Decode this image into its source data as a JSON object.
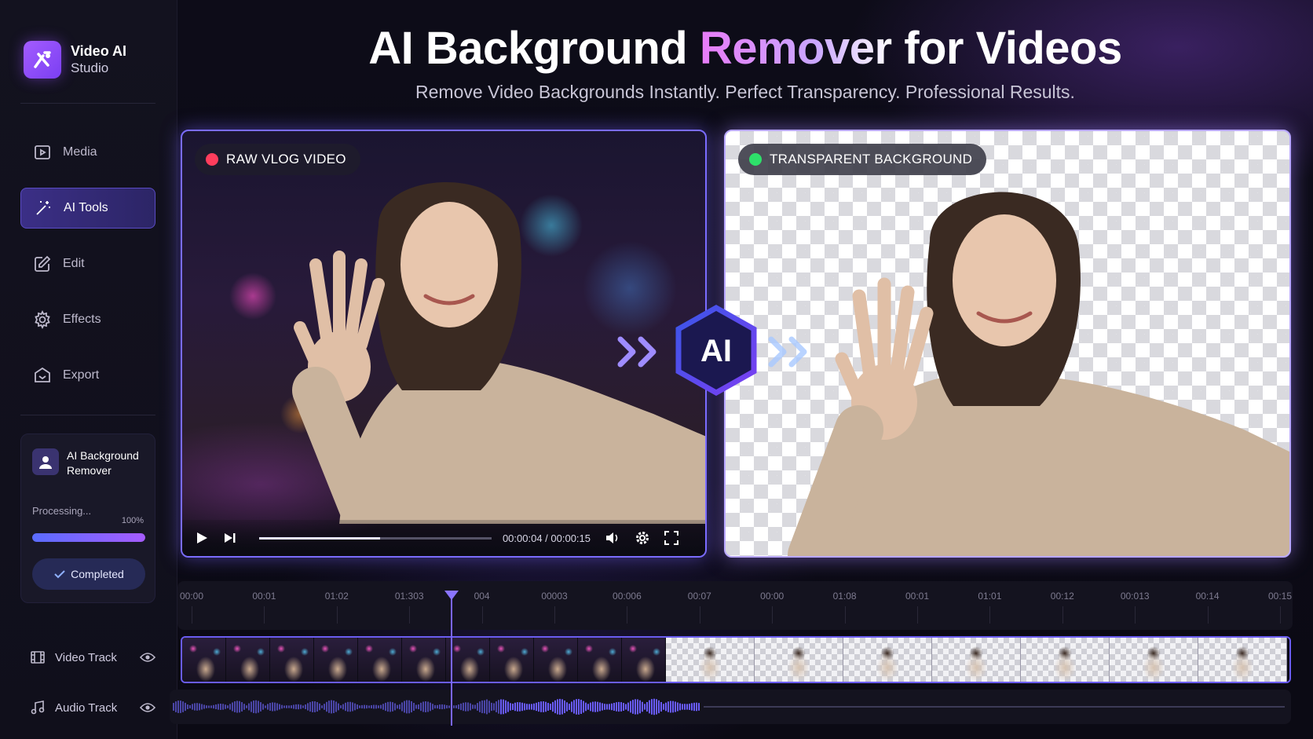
{
  "brand": {
    "name": "Video AI",
    "sub": "Studio"
  },
  "header": {
    "title_part1": "AI Background ",
    "title_part2": "Remover",
    "title_part3": " for Videos",
    "subtitle": "Remove Video Backgrounds Instantly. Perfect Transparency. Professional Results."
  },
  "sidebar": {
    "items": [
      {
        "label": "Media",
        "icon": "folder-icon"
      },
      {
        "label": "AI Tools",
        "icon": "magic-wand-icon",
        "active": true
      },
      {
        "label": "Edit",
        "icon": "edit-icon"
      },
      {
        "label": "Effects",
        "icon": "gear-icon"
      },
      {
        "label": "Export",
        "icon": "export-icon"
      }
    ]
  },
  "tool_card": {
    "name": "AI Background Remover",
    "status": "Processing...",
    "percent_label": "100%",
    "progress": 1.0,
    "button": "Completed"
  },
  "left_panel": {
    "badge": "RAW VLOG VIDEO",
    "badge_color": "#ff3d5c",
    "time": "00:00:04 / 00:00:15",
    "progress": 0.52
  },
  "right_panel": {
    "badge": "TRANSPARENT BACKGROUND",
    "badge_color": "#2ee06a"
  },
  "ai_badge": {
    "label": "AI"
  },
  "timeline": {
    "ticks": [
      "00:00",
      "00:01",
      "01:02",
      "01:303",
      "004",
      "00003",
      "00:006",
      "00:07",
      "00:00",
      "01:08",
      "00:01",
      "01:01",
      "00:12",
      "00:013",
      "00:14",
      "00:15"
    ],
    "tracks": [
      {
        "label": "Video Track",
        "icon": "film-icon"
      },
      {
        "label": "Audio Track",
        "icon": "music-icon"
      }
    ]
  },
  "colors": {
    "accent": "#7a6cff",
    "bg": "#0d0c18"
  }
}
